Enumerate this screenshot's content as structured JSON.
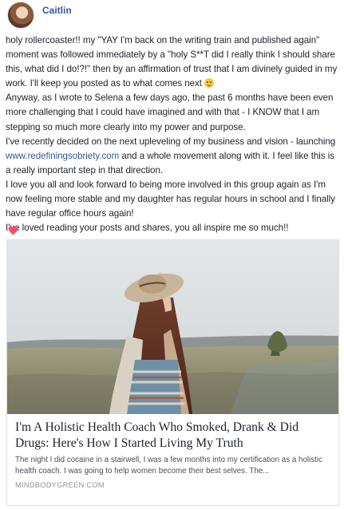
{
  "post": {
    "author": "Caitlin",
    "paragraphs": [
      {
        "segments": [
          {
            "text": "holy rollercoaster!! my \"YAY I'm back on the writing train and published again\" moment was followed immediately by a \"holy S**T did I really think I should share this, what did I do!?!\" then by an affirmation of trust that I am divinely guided in my work. I'll keep you posted as to what comes next "
          },
          {
            "emoji": "smile-emoji"
          }
        ]
      },
      {
        "segments": [
          {
            "text": "Anyway, as I wrote to Selena a few days ago, the past 6 months have been even more challenging that I could have imagined and with that - I KNOW that I am stepping so much more clearly into my power and purpose."
          }
        ]
      },
      {
        "segments": [
          {
            "text": "I've recently decided on the next upleveling of my business and vision - launching "
          },
          {
            "link": "www.redefiningsobriety.com"
          },
          {
            "text": " and a whole movement along with it. I feel like this is a really important step in that direction."
          }
        ]
      },
      {
        "segments": [
          {
            "text": "I love you all and look forward to being more involved in this group again as I'm now feeling more stable and my daughter has regular hours in school and I finally have regular office hours again!"
          }
        ]
      },
      {
        "segments": [
          {
            "text": "I've loved reading your posts and shares, you all inspire me so much!!"
          }
        ]
      }
    ],
    "heart_icon": "heart-emoji",
    "heart_color": "#f25268"
  },
  "link_card": {
    "title": "I'm A Holistic Health Coach Who Smoked, Drank & Did Drugs: Here's How I Started Living My Truth",
    "description": "The night I did cocaine in a stairwell, I was a few months into my certification as a holistic health coach. I was going to help women become their best selves. The...",
    "domain": "MINDBODYGREEN.COM",
    "image_icon": "woman-in-field-photo"
  },
  "colors": {
    "author": "#365899",
    "link": "#365899",
    "text": "#1d2129",
    "muted": "#90949c"
  }
}
